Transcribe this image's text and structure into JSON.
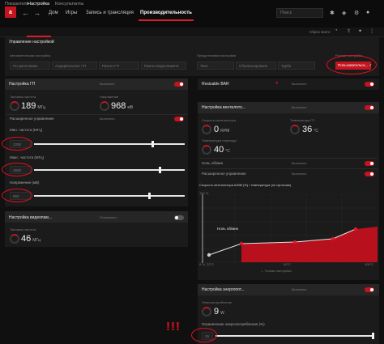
{
  "topbar": {
    "logo": "a",
    "nav": [
      "Дом",
      "Игры",
      "Запись и трансляция",
      "Производительность"
    ],
    "search_placeholder": "Поиск"
  },
  "subtabs": [
    "Показатели",
    "Настройка",
    "Консультанты"
  ],
  "sub_right_text": "Сброс всего",
  "control_panel": {
    "title": "Управление настройкой",
    "left_label": "Автоматическая настройка",
    "buttons": [
      "По умолчанию",
      "Андервольтинг ГП",
      "Разгон ГП",
      "Разгон видеопамяти"
    ],
    "preset_label": "Предустановки настройки",
    "presets": [
      "Тихо",
      "Сбалансировано",
      "Турбо"
    ],
    "manual_label": "Ручная настройка",
    "manual_button": "Пользовательск..."
  },
  "gpu_panel": {
    "title": "Настройка ГП",
    "toggle_label": "Включено",
    "clock_label": "Тактовая частота",
    "clock_value": "189",
    "clock_unit": "МГц",
    "voltage_label": "Напряжение",
    "voltage_value": "968",
    "voltage_unit": "мВ",
    "advanced_label": "Расширенное управление",
    "advanced_toggle": "Включено",
    "min_freq_label": "Мин. частота (МГц)",
    "min_freq_value": "2200",
    "max_freq_label": "Макс. частота (МГц)",
    "max_freq_value": "2600",
    "voltage_mv_label": "Напряжение (мВ)",
    "voltage_mv_value": "950",
    "sliders": {
      "min_freq": 0.78,
      "max_freq": 0.83,
      "voltage": 0.76
    }
  },
  "vram_panel": {
    "title": "Настройка видеопам...",
    "toggle_label": "Отключено",
    "clock_label": "Тактовая частота",
    "clock_value": "46",
    "clock_unit": "МГц"
  },
  "rebar": {
    "title": "Resizable BAR",
    "toggle_label": "Включено"
  },
  "fan_panel": {
    "title": "Настройка вентилято...",
    "toggle_label": "Включено",
    "fan_speed_label": "Скорость вентилятора",
    "fan_speed_value": "0",
    "fan_speed_unit": "RPM",
    "gpu_temp_label": "Температура ГП",
    "gpu_temp_value": "36",
    "gpu_temp_unit": "°C",
    "junction_label": "Температура перехода",
    "junction_value": "40",
    "junction_unit": "°C",
    "zero_rpm_label": "Ноль об/мин",
    "zero_rpm_toggle": "Включено",
    "advanced_label": "Расширенное управление",
    "advanced_toggle": "Включено",
    "curve_title": "Скорость вентилятора ШИМ (%) / температура (по Цельсию)",
    "curve_ytop": "100 %",
    "curve_zero_label": "Ноль об/мин",
    "curve_bottom_left": "0 %, 22°C",
    "curve_bottom_mid": "50°C",
    "curve_bottom_right": "100°C",
    "curve_link": "Точная настройка"
  },
  "power_panel": {
    "title": "Настройка энергопот...",
    "toggle_label": "Включено",
    "consumption_label": "Энергопотребление",
    "consumption_value": "9",
    "consumption_unit": "W",
    "limit_label": "Ограничение энергопотребления (%)",
    "limit_value": "15"
  },
  "annotation_marks": "!!!",
  "colors": {
    "accent": "#c4141f",
    "annotation": "#e0101f"
  }
}
